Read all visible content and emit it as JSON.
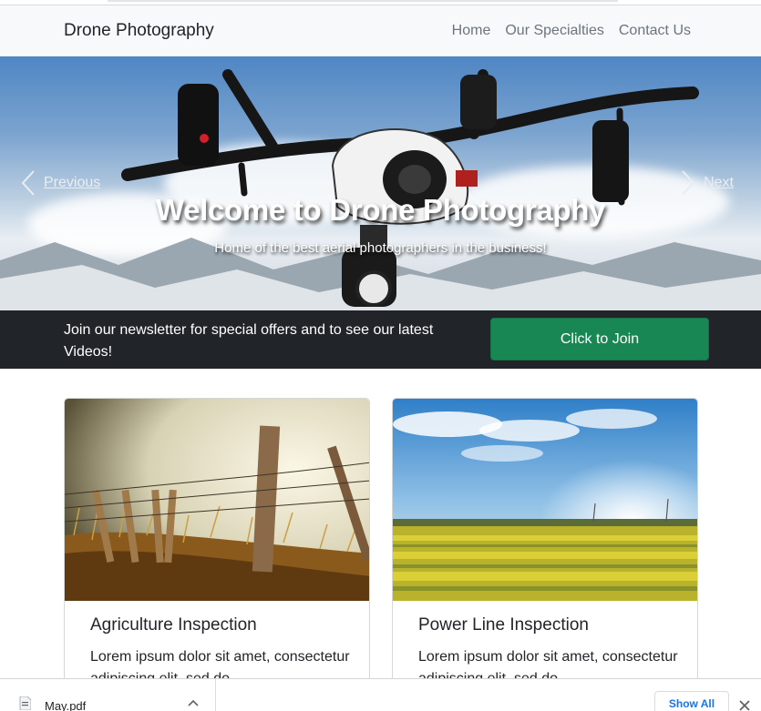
{
  "navbar": {
    "brand": "Drone Photography",
    "links": [
      "Home",
      "Our Specialties",
      "Contact Us"
    ]
  },
  "hero": {
    "title": "Welcome to Drone Photography",
    "subtitle": "Home of the best aerial photographers in the business!",
    "prev_label": "Previous",
    "next_label": "Next"
  },
  "newsletter": {
    "text": "Join our newsletter for special offers and to see our latest Videos!",
    "button_label": "Click to Join"
  },
  "cards": [
    {
      "title": "Agriculture Inspection",
      "text": "Lorem ipsum dolor sit amet, consectetur adipiscing elit, sed do"
    },
    {
      "title": "Power Line Inspection",
      "text": "Lorem ipsum dolor sit amet, consectetur adipiscing elit, sed do"
    }
  ],
  "download_bar": {
    "file_name": "May.pdf",
    "show_all_label": "Show All"
  },
  "colors": {
    "navbar_bg": "#f8f9fa",
    "newsletter_bg": "#212529",
    "join_button": "#198754",
    "show_all_text": "#1a73e8"
  }
}
